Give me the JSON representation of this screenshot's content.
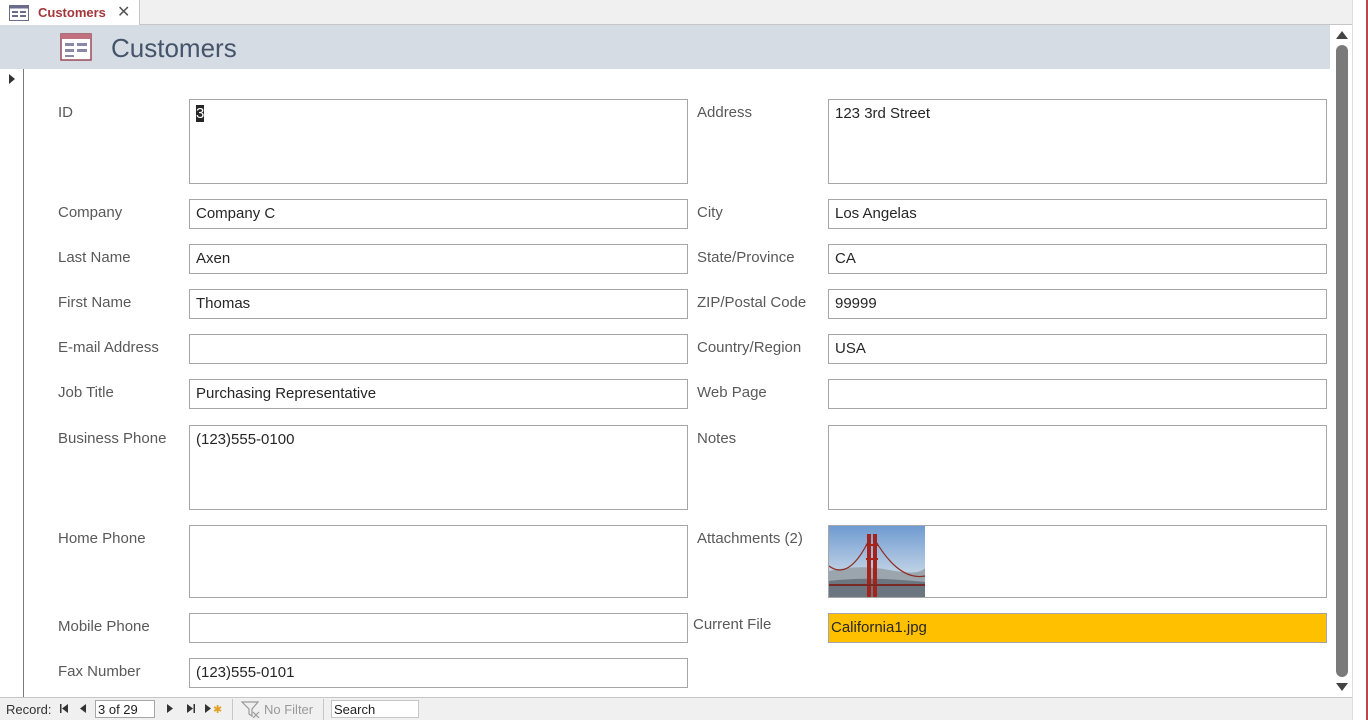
{
  "tab": {
    "label": "Customers",
    "close": "✕"
  },
  "header": {
    "title": "Customers"
  },
  "fields": {
    "id": {
      "label": "ID",
      "value": "3"
    },
    "company": {
      "label": "Company",
      "value": "Company C"
    },
    "last_name": {
      "label": "Last Name",
      "value": "Axen"
    },
    "first_name": {
      "label": "First Name",
      "value": "Thomas"
    },
    "email": {
      "label": "E-mail Address",
      "value": ""
    },
    "job_title": {
      "label": "Job Title",
      "value": "Purchasing Representative"
    },
    "business_phone": {
      "label": "Business Phone",
      "value": "(123)555-0100"
    },
    "home_phone": {
      "label": "Home Phone",
      "value": ""
    },
    "mobile_phone": {
      "label": "Mobile Phone",
      "value": ""
    },
    "fax_number": {
      "label": "Fax Number",
      "value": "(123)555-0101"
    },
    "address": {
      "label": "Address",
      "value": "123 3rd Street"
    },
    "city": {
      "label": "City",
      "value": "Los Angelas"
    },
    "state": {
      "label": "State/Province",
      "value": "CA"
    },
    "zip": {
      "label": "ZIP/Postal Code",
      "value": "99999"
    },
    "country": {
      "label": "Country/Region",
      "value": "USA"
    },
    "web_page": {
      "label": "Web Page",
      "value": ""
    },
    "notes": {
      "label": "Notes",
      "value": ""
    },
    "attachments": {
      "label": "Attachments (2)",
      "thumbnail": "golden-gate-bridge-photo"
    },
    "current_file": {
      "label": "Current File",
      "value": "California1.jpg"
    }
  },
  "navbar": {
    "record_label": "Record:",
    "record_position": "3 of 29",
    "filter_label": "No Filter",
    "search_placeholder": "Search"
  },
  "colors": {
    "header_bg": "#d6dce4",
    "header_title": "#44546a",
    "tab_label": "#a4373a",
    "current_file_bg": "#ffc000"
  }
}
